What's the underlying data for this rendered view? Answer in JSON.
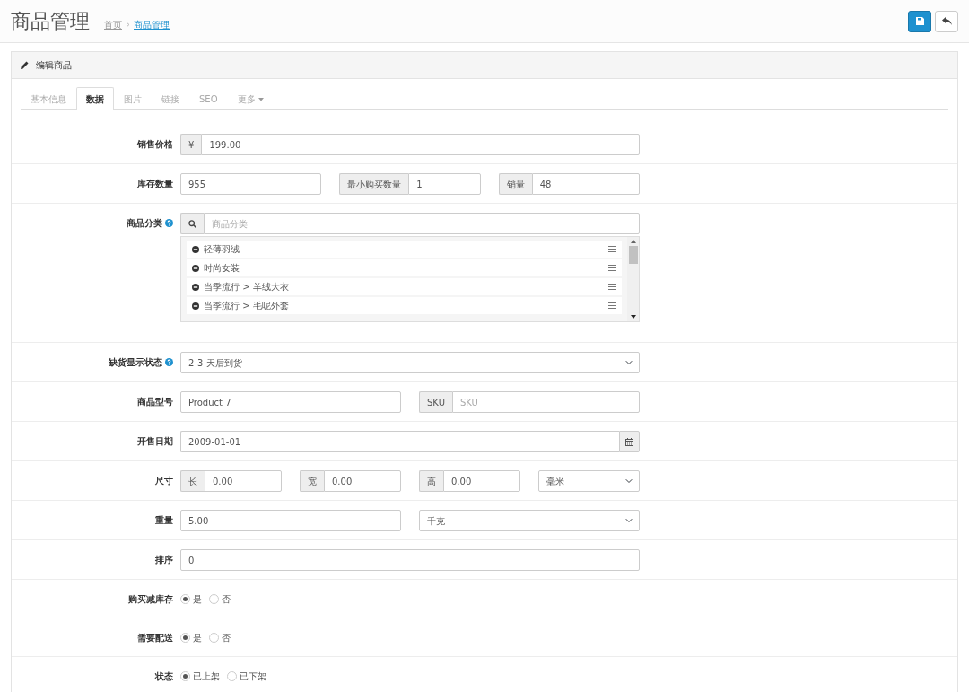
{
  "header": {
    "title": "商品管理",
    "breadcrumb": [
      {
        "label": "首页",
        "active": false
      },
      {
        "label": "商品管理",
        "active": true
      }
    ]
  },
  "panel": {
    "title": "编辑商品"
  },
  "tabs": [
    {
      "label": "基本信息",
      "selected": false,
      "kind": "plain"
    },
    {
      "label": "数据",
      "selected": true,
      "kind": "plain"
    },
    {
      "label": "图片",
      "selected": false,
      "kind": "plain"
    },
    {
      "label": "链接",
      "selected": false,
      "kind": "plain"
    },
    {
      "label": "SEO",
      "selected": false,
      "kind": "plain"
    },
    {
      "label": "更多",
      "selected": false,
      "kind": "dropdown"
    }
  ],
  "form": {
    "rows": [
      {
        "label": "销售价格",
        "kind": "fields",
        "fields": [
          {
            "kind": "input",
            "prefix": "¥",
            "value": "199.00"
          }
        ]
      },
      {
        "label": "库存数量",
        "kind": "fields",
        "fields": [
          {
            "kind": "input",
            "value": "955"
          },
          {
            "kind": "input",
            "prefix": "最小购买数量",
            "value": "1"
          },
          {
            "kind": "input",
            "prefix": "销量",
            "value": "48"
          }
        ]
      },
      {
        "label": "商品分类",
        "help": true,
        "kind": "category",
        "placeholder": "商品分类",
        "items": [
          "轻薄羽绒",
          "时尚女装",
          "当季流行 > 羊绒大衣",
          "当季流行 > 毛呢外套"
        ]
      },
      {
        "label": "缺货显示状态",
        "help": true,
        "kind": "fields",
        "fields": [
          {
            "kind": "select",
            "value": "2-3 天后到货"
          }
        ]
      },
      {
        "label": "商品型号",
        "kind": "fields",
        "fields": [
          {
            "kind": "input",
            "value": "Product 7"
          },
          {
            "kind": "input",
            "prefix": "SKU",
            "placeholder": "SKU"
          }
        ]
      },
      {
        "label": "开售日期",
        "kind": "fields",
        "fields": [
          {
            "kind": "date",
            "value": "2009-01-01"
          }
        ]
      },
      {
        "label": "尺寸",
        "kind": "fields",
        "fields": [
          {
            "kind": "input",
            "prefix": "长",
            "value": "0.00"
          },
          {
            "kind": "input",
            "prefix": "宽",
            "value": "0.00"
          },
          {
            "kind": "input",
            "prefix": "高",
            "value": "0.00"
          },
          {
            "kind": "select",
            "value": "毫米"
          }
        ]
      },
      {
        "label": "重量",
        "kind": "fields",
        "fields": [
          {
            "kind": "input",
            "value": "5.00"
          },
          {
            "kind": "select",
            "value": "千克"
          }
        ]
      },
      {
        "label": "排序",
        "kind": "fields",
        "fields": [
          {
            "kind": "input",
            "value": "0"
          }
        ]
      },
      {
        "label": "购买减库存",
        "kind": "radio",
        "options": [
          {
            "label": "是",
            "selected": true
          },
          {
            "label": "否",
            "selected": false
          }
        ]
      },
      {
        "label": "需要配送",
        "kind": "radio",
        "options": [
          {
            "label": "是",
            "selected": true
          },
          {
            "label": "否",
            "selected": false
          }
        ]
      },
      {
        "label": "状态",
        "kind": "radio",
        "options": [
          {
            "label": "已上架",
            "selected": true
          },
          {
            "label": "已下架",
            "selected": false
          }
        ]
      }
    ]
  }
}
